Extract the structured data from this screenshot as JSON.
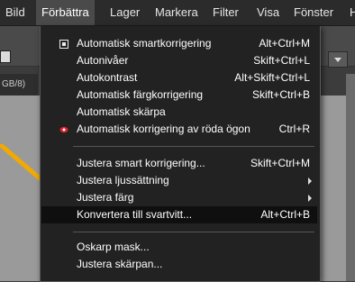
{
  "menubar": {
    "items": [
      "Bild",
      "Förbättra",
      "Lager",
      "Markera",
      "Filter",
      "Visa",
      "Fönster",
      "H"
    ],
    "active_index": 1
  },
  "document_tab": {
    "label": "GB/8)"
  },
  "menu": {
    "items": [
      {
        "label": "Automatisk smartkorrigering",
        "shortcut": "Alt+Ctrl+M",
        "icon": "smart-fix-icon"
      },
      {
        "label": "Autonivåer",
        "shortcut": "Skift+Ctrl+L"
      },
      {
        "label": "Autokontrast",
        "shortcut": "Alt+Skift+Ctrl+L"
      },
      {
        "label": "Automatisk färgkorrigering",
        "shortcut": "Skift+Ctrl+B"
      },
      {
        "label": "Automatisk skärpa",
        "shortcut": ""
      },
      {
        "label": "Automatisk korrigering av röda ögon",
        "shortcut": "Ctrl+R",
        "icon": "red-eye-icon"
      },
      {
        "label": "Justera smart korrigering...",
        "shortcut": "Skift+Ctrl+M"
      },
      {
        "label": "Justera ljussättning",
        "shortcut": "",
        "submenu": true
      },
      {
        "label": "Justera färg",
        "shortcut": "",
        "submenu": true
      },
      {
        "label": "Konvertera till svartvitt...",
        "shortcut": "Alt+Ctrl+B",
        "highlighted": true
      },
      {
        "label": "Oskarp mask...",
        "shortcut": ""
      },
      {
        "label": "Justera skärpan...",
        "shortcut": ""
      }
    ]
  },
  "colors": {
    "annotation_arrow": "#f2a900",
    "red_eye_icon": "#e0202a",
    "menu_background": "#222222",
    "highlight_background": "#0f0f0f"
  }
}
